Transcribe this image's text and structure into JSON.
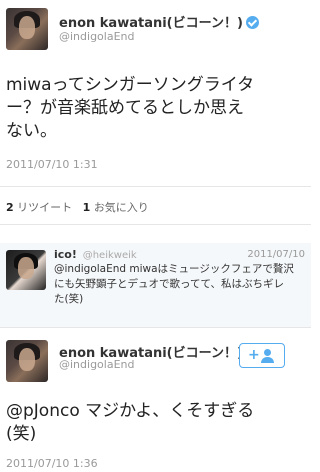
{
  "tweet": {
    "author_name": "enon kawatani(ビコーン！)",
    "author_handle": "@indigolaEnd",
    "text_line1": "miwaってシンガーソングライタ",
    "text_line2": "ー？が音楽舐めてるとしか思え",
    "text_line3": "ない。",
    "timestamp": "2011/07/10 1:31",
    "retweet_count": "2",
    "retweet_label": "リツイート",
    "favorite_count": "1",
    "favorite_label": "お気に入り"
  },
  "reply_context": {
    "author_name": "ico!",
    "author_handle": "@heikweik",
    "date": "2011/07/10",
    "text": "@indigolaEnd miwaはミュージックフェアで贅沢にも矢野顕子とデュオで歌ってて、私はぶちギレた(笑)"
  },
  "reply": {
    "author_name": "enon kawatani(ビコーン！)",
    "author_handle": "@indigolaEnd",
    "text_line1": "@pJonco マジかよ、くそすぎる",
    "text_line2": "(笑)",
    "timestamp": "2011/07/10 1:36"
  },
  "colors": {
    "accent": "#55acee",
    "muted_text": "#9a9a9a",
    "reply_background": "#f5f8fa"
  },
  "icons": {
    "verified": "verified-badge-icon",
    "follow": "follow-user-icon"
  }
}
